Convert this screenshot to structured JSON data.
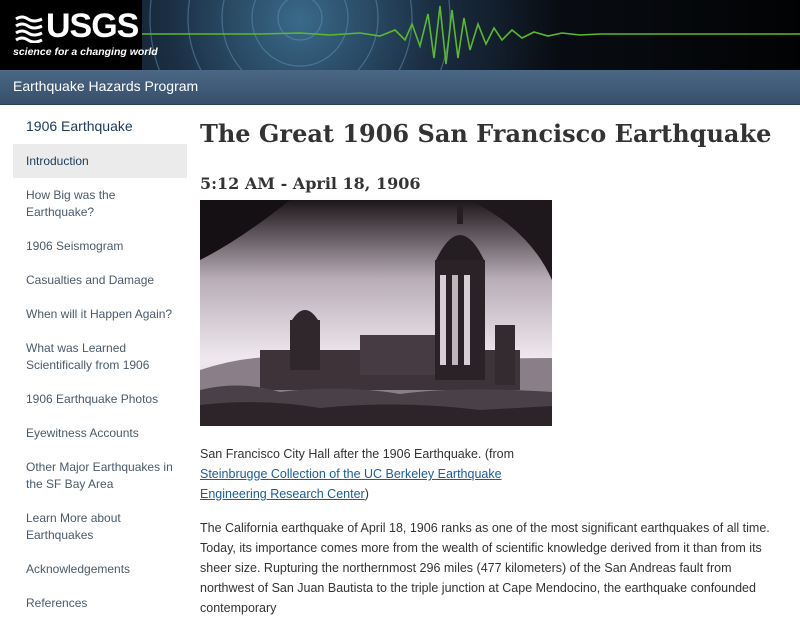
{
  "header": {
    "logo_text": "USGS",
    "logo_tagline": "science for a changing world",
    "program_link": "Earthquake Hazards Program"
  },
  "sidebar": {
    "title": "1906 Earthquake",
    "items": [
      {
        "label": "Introduction",
        "active": true
      },
      {
        "label": "How Big was the Earthquake?"
      },
      {
        "label": "1906 Seismogram"
      },
      {
        "label": "Casualties and Damage"
      },
      {
        "label": "When will it Happen Again?"
      },
      {
        "label": "What was Learned Scientifically from 1906"
      },
      {
        "label": "1906 Earthquake Photos"
      },
      {
        "label": "Eyewitness Accounts"
      },
      {
        "label": "Other Major Earthquakes in the SF Bay Area"
      },
      {
        "label": "Learn More about Earthquakes"
      },
      {
        "label": "Acknowledgements"
      },
      {
        "label": "References"
      }
    ]
  },
  "main": {
    "title": "The Great 1906 San Francisco Earthquake",
    "subtitle": "5:12 AM - April 18, 1906",
    "caption_before": "San Francisco City Hall after the 1906 Earthquake. (from ",
    "caption_link": "Steinbrugge Collection of the UC Berkeley Earthquake Engineering Research Center",
    "caption_after": ")",
    "paragraph": "The California earthquake of April 18, 1906 ranks as one of the most significant earthquakes of all time. Today, its importance comes more from the wealth of scientific knowledge derived from it than from its sheer size. Rupturing the northernmost 296 miles (477 kilometers) of the San Andreas fault from northwest of San Juan Bautista to the triple junction at Cape Mendocino, the earthquake confounded contemporary"
  },
  "colors": {
    "program_bar": "#4a6785",
    "link": "#1a5c9c",
    "seismic_green": "#5cb82e",
    "active_bg": "#ebebeb"
  }
}
